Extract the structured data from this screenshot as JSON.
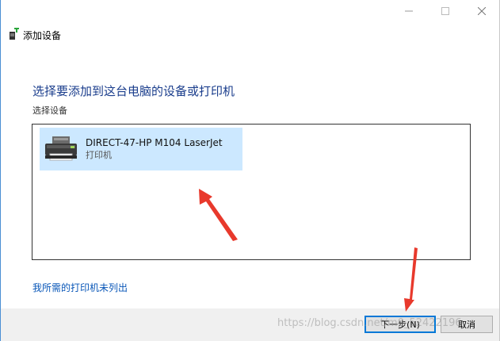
{
  "window": {
    "title": "添加设备",
    "controls": [
      "minimize-icon",
      "maximize-icon",
      "close-icon"
    ]
  },
  "main": {
    "heading": "选择要添加到这台电脑的设备或打印机",
    "select_label": "选择设备",
    "devices": [
      {
        "name": "DIRECT-47-HP M104 LaserJet",
        "type": "打印机",
        "icon": "printer-icon",
        "selected": true
      }
    ],
    "not_listed_link": "我所需的打印机未列出"
  },
  "footer": {
    "next_label": "下一步(N)",
    "cancel_label": "取消"
  },
  "colors": {
    "accent": "#0078d7",
    "heading": "#1a3d8c",
    "selection": "#cce8ff",
    "link": "#0a57b8",
    "annotation": "#e8392c"
  },
  "watermark": "https://blog.csdn.net/m0_52422196"
}
